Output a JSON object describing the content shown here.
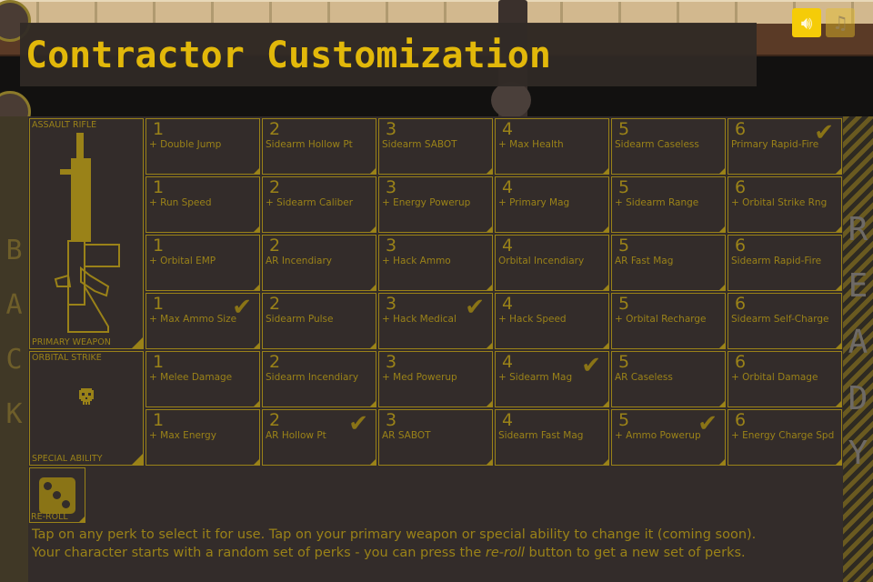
{
  "title": "Contractor Customization",
  "top_buttons": {
    "sound_icon": "speaker-icon",
    "music_icon": "music-note-icon"
  },
  "back_button": {
    "letters": [
      "B",
      "A",
      "C",
      "K"
    ]
  },
  "ready_button": {
    "letters": [
      "R",
      "E",
      "A",
      "D",
      "Y"
    ]
  },
  "primary_weapon": {
    "name": "ASSAULT RIFLE",
    "caption": "PRIMARY WEAPON",
    "icon": "assault-rifle-icon"
  },
  "special_ability": {
    "name": "ORBITAL STRIKE",
    "caption": "SPECIAL ABILITY",
    "icon": "skull-icon"
  },
  "reroll": {
    "label": "RE-ROLL",
    "icon": "dice-icon"
  },
  "perk_rows": [
    [
      {
        "tier": "1",
        "label": "+ Double Jump",
        "selected": false
      },
      {
        "tier": "2",
        "label": "Sidearm Hollow Pt",
        "selected": false
      },
      {
        "tier": "3",
        "label": "Sidearm SABOT",
        "selected": false
      },
      {
        "tier": "4",
        "label": "+ Max Health",
        "selected": false
      },
      {
        "tier": "5",
        "label": "Sidearm Caseless",
        "selected": false
      },
      {
        "tier": "6",
        "label": "Primary Rapid-Fire",
        "selected": true
      }
    ],
    [
      {
        "tier": "1",
        "label": "+ Run Speed",
        "selected": false
      },
      {
        "tier": "2",
        "label": "+ Sidearm Caliber",
        "selected": false
      },
      {
        "tier": "3",
        "label": "+ Energy Powerup",
        "selected": false
      },
      {
        "tier": "4",
        "label": "+ Primary Mag",
        "selected": false
      },
      {
        "tier": "5",
        "label": "+ Sidearm Range",
        "selected": false
      },
      {
        "tier": "6",
        "label": "+ Orbital Strike Rng",
        "selected": false
      }
    ],
    [
      {
        "tier": "1",
        "label": "+ Orbital EMP",
        "selected": false
      },
      {
        "tier": "2",
        "label": "AR Incendiary",
        "selected": false
      },
      {
        "tier": "3",
        "label": "+ Hack Ammo",
        "selected": false
      },
      {
        "tier": "4",
        "label": "Orbital Incendiary",
        "selected": false
      },
      {
        "tier": "5",
        "label": "AR Fast Mag",
        "selected": false
      },
      {
        "tier": "6",
        "label": "Sidearm Rapid-Fire",
        "selected": false
      }
    ],
    [
      {
        "tier": "1",
        "label": "+ Max Ammo Size",
        "selected": true
      },
      {
        "tier": "2",
        "label": "Sidearm Pulse",
        "selected": false
      },
      {
        "tier": "3",
        "label": "+ Hack Medical",
        "selected": true
      },
      {
        "tier": "4",
        "label": "+ Hack Speed",
        "selected": false
      },
      {
        "tier": "5",
        "label": "+ Orbital Recharge",
        "selected": false
      },
      {
        "tier": "6",
        "label": "Sidearm Self-Charge",
        "selected": false
      }
    ],
    [
      {
        "tier": "1",
        "label": "+ Melee Damage",
        "selected": false
      },
      {
        "tier": "2",
        "label": "Sidearm Incendiary",
        "selected": false
      },
      {
        "tier": "3",
        "label": "+ Med Powerup",
        "selected": false
      },
      {
        "tier": "4",
        "label": "+ Sidearm Mag",
        "selected": true
      },
      {
        "tier": "5",
        "label": "AR Caseless",
        "selected": false
      },
      {
        "tier": "6",
        "label": "+ Orbital Damage",
        "selected": false
      }
    ],
    [
      {
        "tier": "1",
        "label": "+ Max Energy",
        "selected": false
      },
      {
        "tier": "2",
        "label": "AR Hollow Pt",
        "selected": true
      },
      {
        "tier": "3",
        "label": "AR SABOT",
        "selected": false
      },
      {
        "tier": "4",
        "label": "Sidearm Fast Mag",
        "selected": false
      },
      {
        "tier": "5",
        "label": "+ Ammo Powerup",
        "selected": true
      },
      {
        "tier": "6",
        "label": "+ Energy Charge Spd",
        "selected": false
      }
    ]
  ],
  "check_glyph": "✔",
  "help": {
    "line1": "Tap on any perk to select it for use. Tap on your primary weapon or special ability to change it (coming soon).",
    "line2_before": "Your character starts with a random set of perks - you can press the ",
    "line2_em": "re-roll",
    "line2_after": " button to get a new set of perks."
  },
  "colors": {
    "accent": "#9a8218",
    "title": "#e2b80a",
    "panel": "#332c2a",
    "sound_button": "#f5cc08"
  }
}
